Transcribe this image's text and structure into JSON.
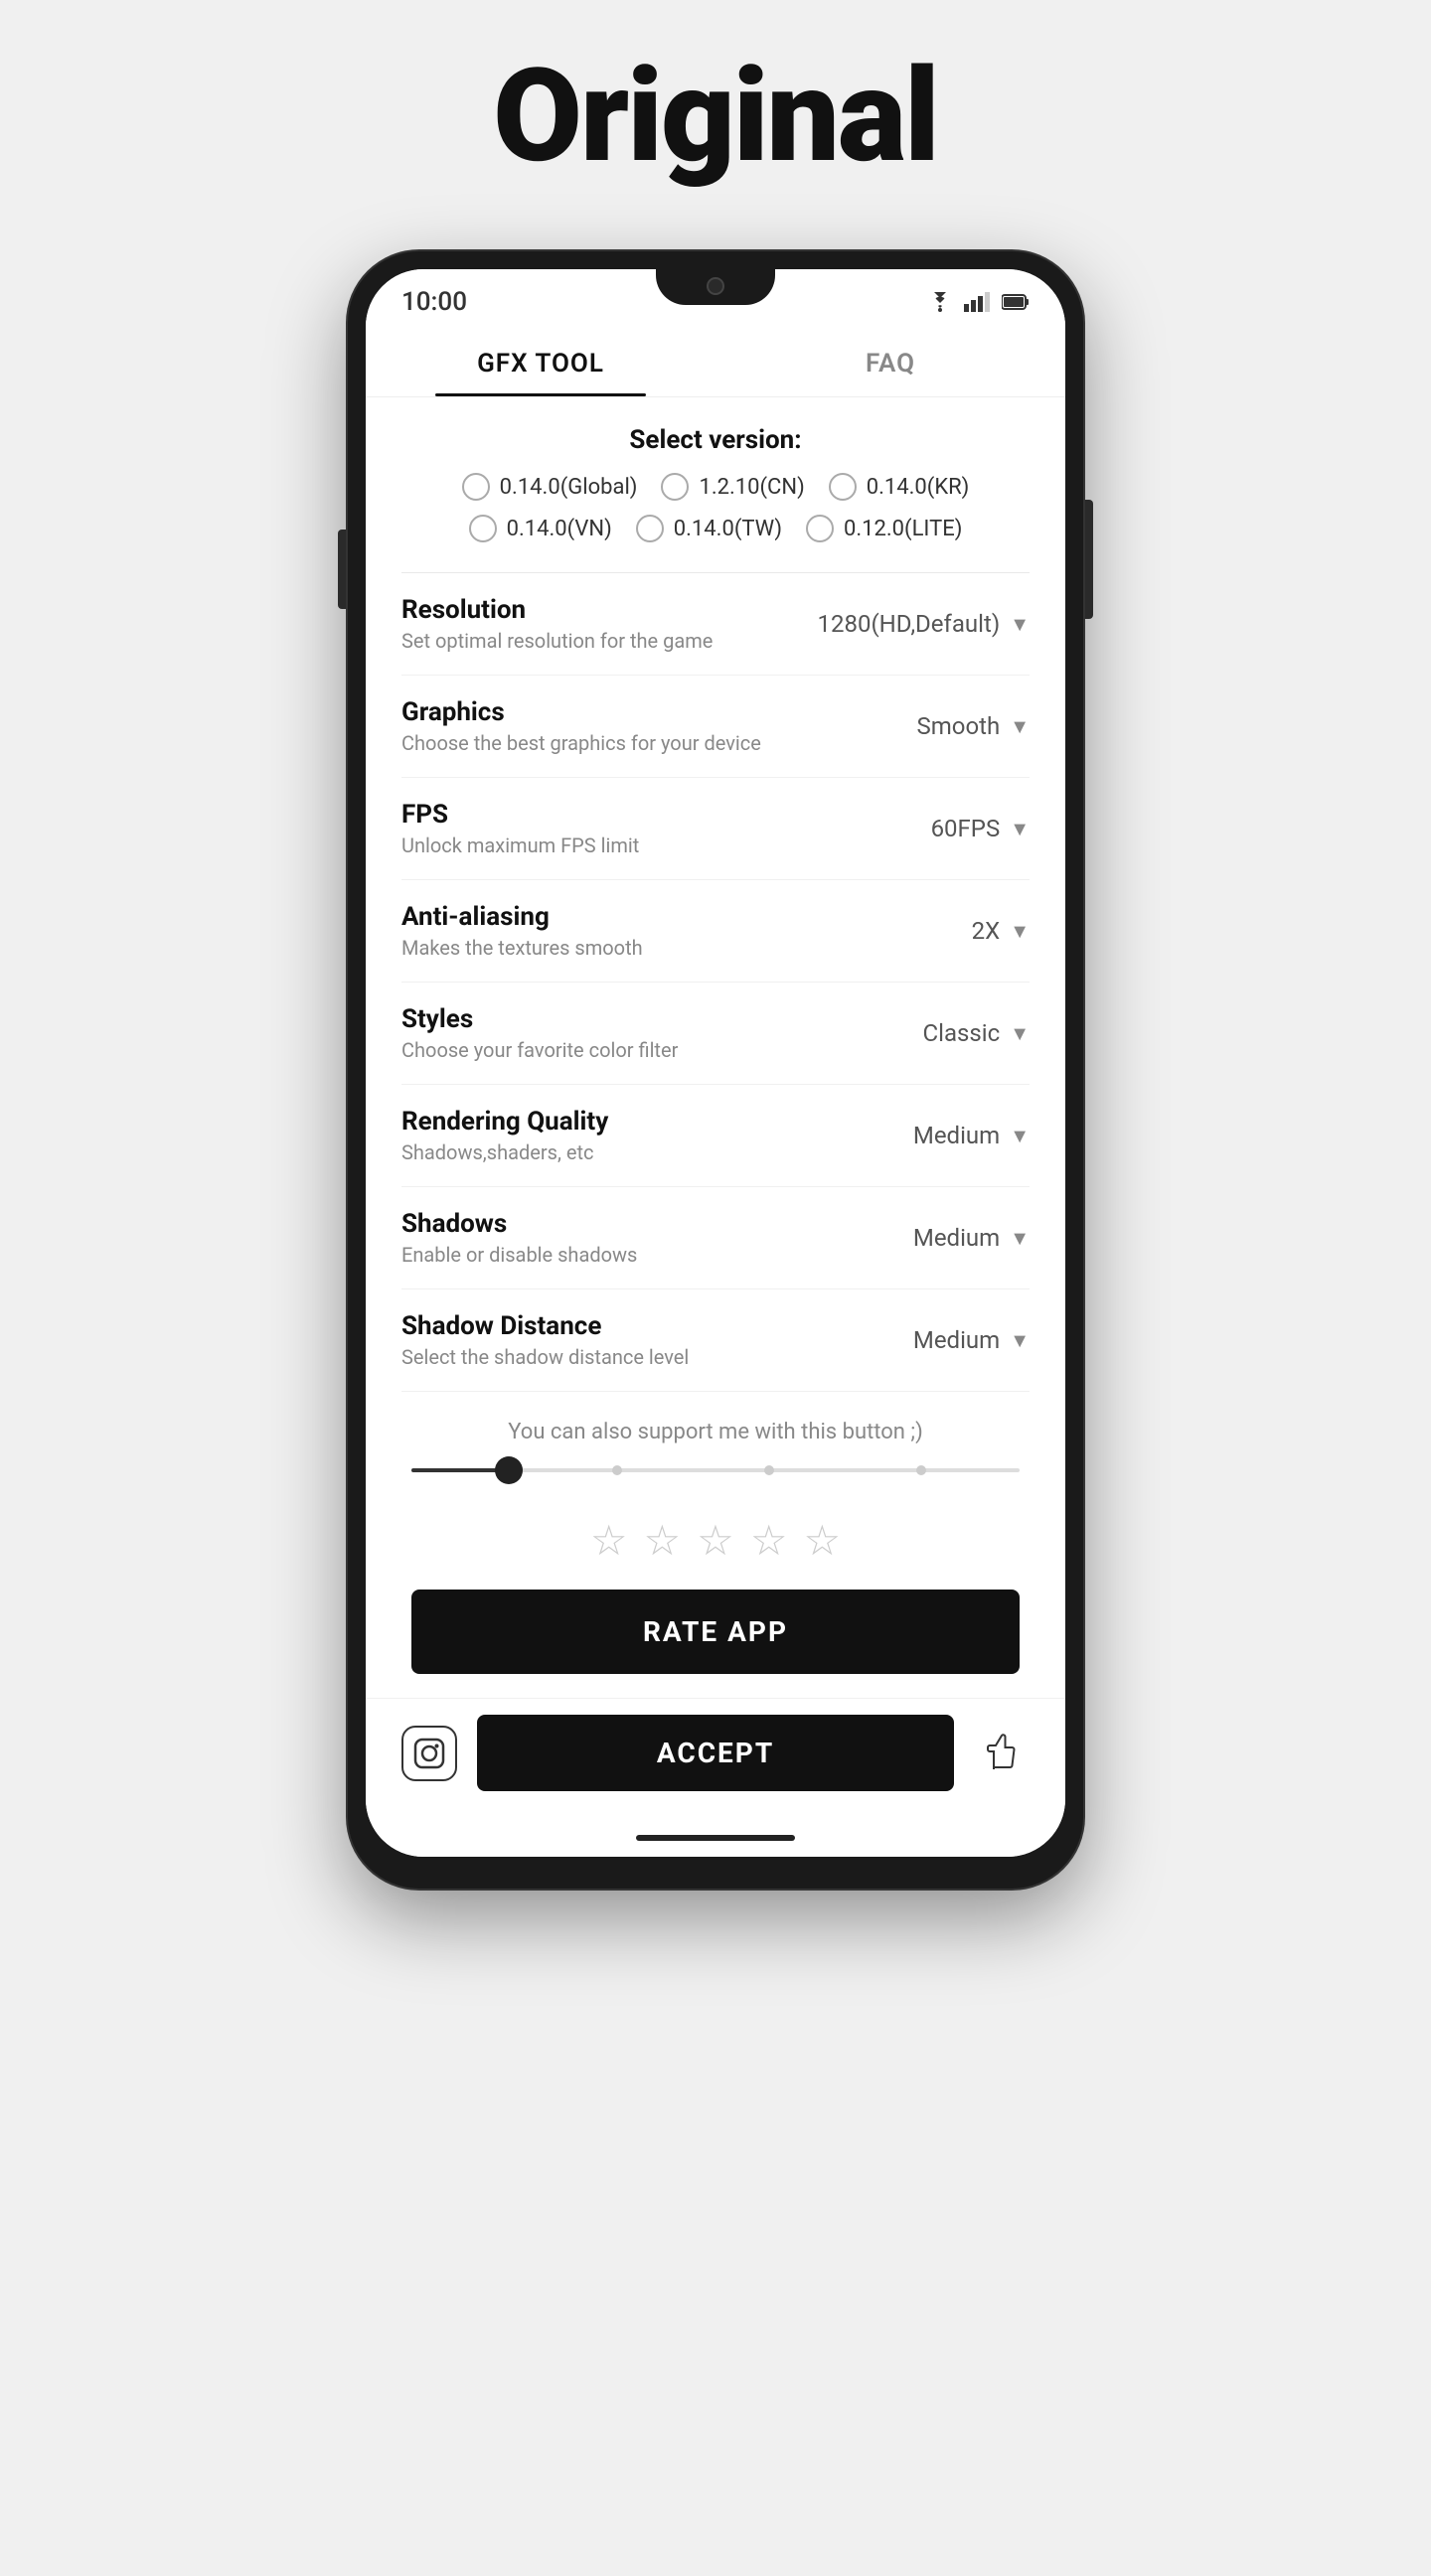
{
  "page": {
    "title": "Original",
    "background_color": "#f0f0f0"
  },
  "status_bar": {
    "time": "10:00"
  },
  "tabs": [
    {
      "id": "gfx-tool",
      "label": "GFX TOOL",
      "active": true
    },
    {
      "id": "faq",
      "label": "FAQ",
      "active": false
    }
  ],
  "select_version": {
    "title": "Select version:",
    "options": [
      {
        "id": "global",
        "label": "0.14.0(Global)"
      },
      {
        "id": "cn",
        "label": "1.2.10(CN)"
      },
      {
        "id": "kr",
        "label": "0.14.0(KR)"
      },
      {
        "id": "vn",
        "label": "0.14.0(VN)"
      },
      {
        "id": "tw",
        "label": "0.14.0(TW)"
      },
      {
        "id": "lite",
        "label": "0.12.0(LITE)"
      }
    ]
  },
  "settings": [
    {
      "id": "resolution",
      "label": "Resolution",
      "desc": "Set optimal resolution for the game",
      "value": "1280(HD,Default)"
    },
    {
      "id": "graphics",
      "label": "Graphics",
      "desc": "Choose the best graphics for your device",
      "value": "Smooth"
    },
    {
      "id": "fps",
      "label": "FPS",
      "desc": "Unlock maximum FPS limit",
      "value": "60FPS"
    },
    {
      "id": "anti-aliasing",
      "label": "Anti-aliasing",
      "desc": "Makes the textures smooth",
      "value": "2X"
    },
    {
      "id": "styles",
      "label": "Styles",
      "desc": "Choose your favorite color filter",
      "value": "Classic"
    },
    {
      "id": "rendering-quality",
      "label": "Rendering Quality",
      "desc": "Shadows,shaders, etc",
      "value": "Medium"
    },
    {
      "id": "shadows",
      "label": "Shadows",
      "desc": "Enable or disable shadows",
      "value": "Medium"
    },
    {
      "id": "shadow-distance",
      "label": "Shadow Distance",
      "desc": "Select the shadow distance level",
      "value": "Medium"
    }
  ],
  "support": {
    "text": "You can also support me with this button ;)"
  },
  "rating": {
    "stars_count": 5,
    "button_label": "RATE APP"
  },
  "bottom_bar": {
    "accept_label": "ACCEPT"
  }
}
